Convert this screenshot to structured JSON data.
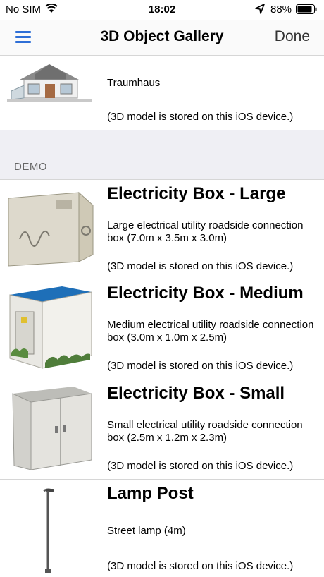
{
  "status": {
    "carrier": "No SIM",
    "time": "18:02",
    "battery": "88%"
  },
  "nav": {
    "title": "3D Object Gallery",
    "done": "Done"
  },
  "top_item": {
    "name": "Traumhaus",
    "note": "(3D model is stored on this iOS device.)"
  },
  "section": {
    "label": "DEMO"
  },
  "items": [
    {
      "title": "Electricity Box - Large",
      "description": "Large electrical utility roadside connection box (7.0m x 3.5m x 3.0m)",
      "note": "(3D model is stored on this iOS device.)"
    },
    {
      "title": "Electricity Box - Medium",
      "description": "Medium electrical utility roadside connection box (3.0m x 1.0m x 2.5m)",
      "note": "(3D model is stored on this iOS device.)"
    },
    {
      "title": "Electricity Box - Small",
      "description": "Small electrical utility roadside connection box (2.5m x 1.2m x 2.3m)",
      "note": "(3D model is stored on this iOS device.)"
    },
    {
      "title": "Lamp Post",
      "description": "Street lamp (4m)",
      "note": "(3D model is stored on this iOS device.)"
    }
  ],
  "icons": {
    "menu": "hamburger-icon",
    "wifi": "wifi-icon",
    "location": "location-arrow-icon",
    "battery": "battery-icon"
  },
  "colors": {
    "accent": "#2f6fd6",
    "section_bg": "#efeff4"
  }
}
